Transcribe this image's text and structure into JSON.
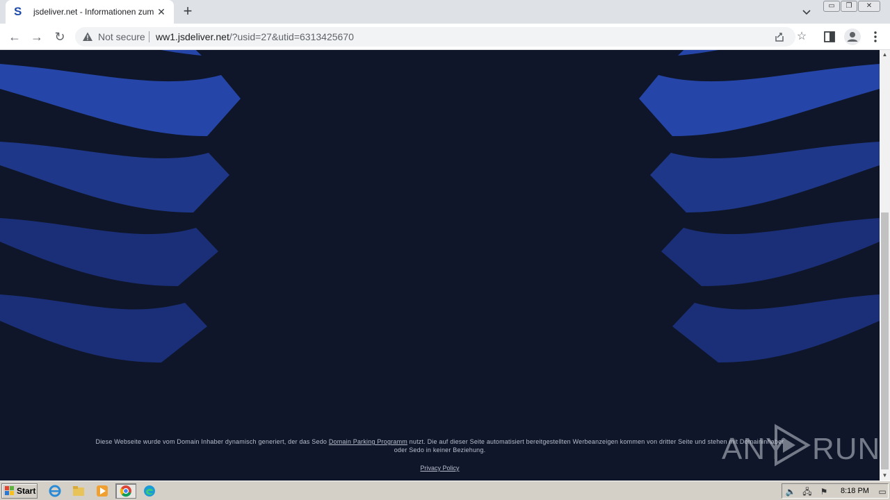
{
  "browser": {
    "tab": {
      "favicon": "S",
      "title": "jsdeliver.net - Informationen zum Th",
      "close": "✕"
    },
    "new_tab": "+",
    "window_controls": {
      "minimize": "▭",
      "restore": "❐",
      "close": "✕"
    },
    "nav": {
      "back": "←",
      "forward": "→",
      "reload": "↻"
    },
    "security_label": "Not secure",
    "url_host": "ww1.jsdeliver.net",
    "url_rest": "/?usid=27&utid=6313425670",
    "icons": [
      "warning-icon",
      "share-icon",
      "star-icon",
      "side-panel-icon",
      "profile-icon",
      "menu-icon"
    ]
  },
  "page": {
    "footer_before_link": "Diese Webseite wurde vom Domain Inhaber dynamisch generiert, der das Sedo ",
    "footer_link": "Domain Parking Programm",
    "footer_after_link": " nutzt. Die auf dieser Seite automatisiert bereitgestellten Werbeanzeigen kommen von dritter Seite und stehen mit Domaininhaber",
    "footer_line2": "oder Sedo in keiner Beziehung.",
    "privacy_link": "Privacy Policy",
    "watermark_any": "ANY",
    "watermark_run": "RUN",
    "colors": {
      "background": "#0f1629",
      "wave_bright": "#2546a8",
      "wave_mid": "#1e3788",
      "wave_dark": "#1b2f78"
    }
  },
  "taskbar": {
    "start_label": "Start",
    "clock": "8:18 PM",
    "apps": [
      "ie-icon",
      "explorer-icon",
      "media-player-icon",
      "chrome-icon",
      "edge-icon"
    ]
  }
}
